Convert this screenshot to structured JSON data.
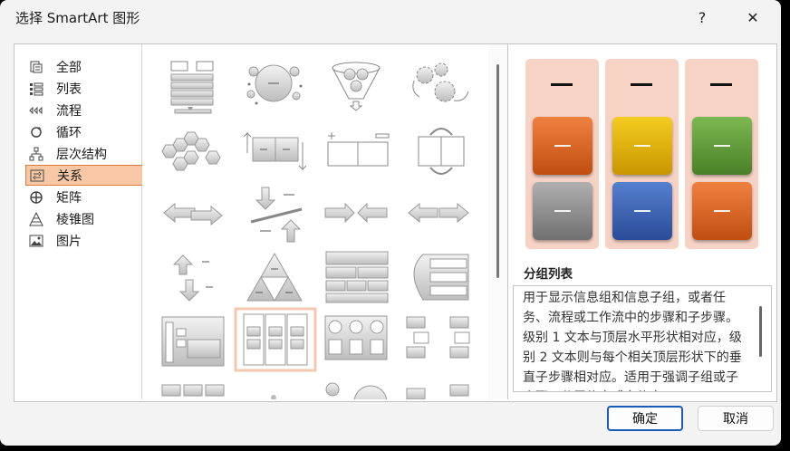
{
  "dialog": {
    "title": "选择 SmartArt 图形",
    "help_label": "?",
    "close_label": "✕"
  },
  "categories": [
    {
      "label": "全部",
      "icon": "all-icon",
      "selected": false
    },
    {
      "label": "列表",
      "icon": "list-icon",
      "selected": false
    },
    {
      "label": "流程",
      "icon": "process-icon",
      "selected": false
    },
    {
      "label": "循环",
      "icon": "cycle-icon",
      "selected": false
    },
    {
      "label": "层次结构",
      "icon": "hierarchy-icon",
      "selected": false
    },
    {
      "label": "关系",
      "icon": "relationship-icon",
      "selected": true
    },
    {
      "label": "矩阵",
      "icon": "matrix-icon",
      "selected": false
    },
    {
      "label": "棱锥图",
      "icon": "pyramid-icon",
      "selected": false
    },
    {
      "label": "图片",
      "icon": "picture-icon",
      "selected": false
    }
  ],
  "preview": {
    "title": "分组列表",
    "description": "用于显示信息组和信息子组，或者任务、流程或工作流中的步骤和子步骤。级别 1 文本与顶层水平形状相对应，级别 2 文本则与每个相关顶层形状下的垂直子步骤相对应。适用于强调子组或子步骤、分层信息或多信息",
    "colors": {
      "col1": [
        "#e0621b",
        "#8c8c8c"
      ],
      "col2": [
        "#e6b400",
        "#3b62b0"
      ],
      "col3": [
        "#5e9c38",
        "#e0621b"
      ],
      "background": "#f7d3c6"
    }
  },
  "buttons": {
    "ok": "确定",
    "cancel": "取消"
  }
}
